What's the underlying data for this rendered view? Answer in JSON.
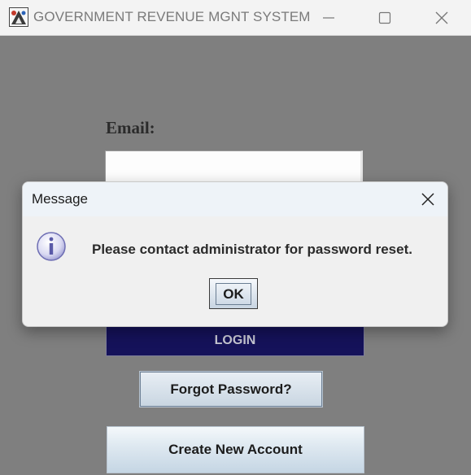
{
  "window": {
    "title": "GOVERNMENT REVENUE MGNT SYSTEM",
    "icons": [
      "java-app-icon",
      "minimize-icon",
      "maximize-icon",
      "close-icon"
    ]
  },
  "login_form": {
    "email_label": "Email:",
    "email_value": "",
    "login_button": "LOGIN",
    "forgot_password_button": "Forgot Password?",
    "create_account_button": "Create New Account"
  },
  "dialog": {
    "title": "Message",
    "message": "Please contact administrator for password reset.",
    "ok_button": "OK",
    "icon": "info-icon"
  },
  "colors": {
    "background": "#7f7f7f",
    "login_button": "#15125a",
    "dialog_background": "#f0f0f0",
    "button_gradient_top": "#e8eef4",
    "button_gradient_bottom": "#c9d6e2"
  }
}
